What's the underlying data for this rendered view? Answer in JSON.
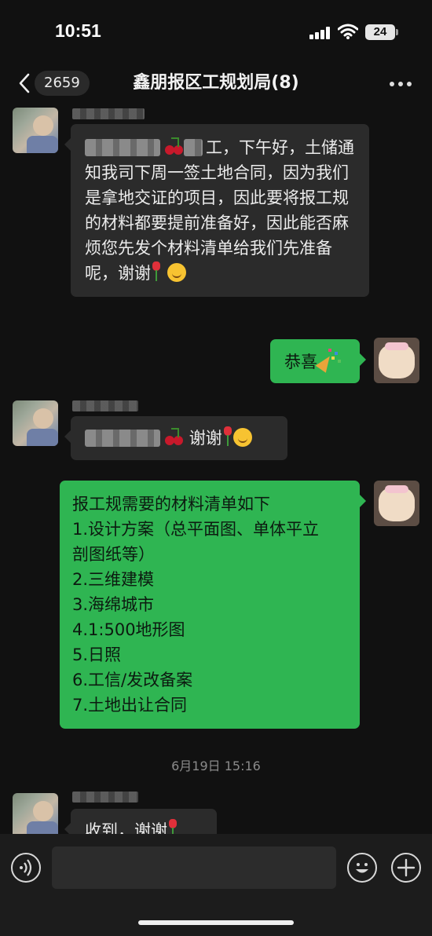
{
  "status_bar": {
    "time": "10:51",
    "battery_level": "24"
  },
  "nav": {
    "back_icon": "chevron-left-icon",
    "unread_count": "2659",
    "title": "鑫朋报区工规划局(8)",
    "more_icon": "more-dots-icon"
  },
  "messages": [
    {
      "side": "left",
      "text_after_name": "工，下午好，土储通知我司下周一签土地合同，因为我们是拿地交证的项目，因此要将报工规的材料都要提前准备好，因此能否麻烦您先发个材料清单给我们先准备呢，谢谢",
      "emojis": [
        "cherry",
        "tulip",
        "smile"
      ]
    },
    {
      "side": "right",
      "text": "恭喜",
      "emojis": [
        "party-popper"
      ]
    },
    {
      "side": "left",
      "text_after_name": "谢谢",
      "emojis": [
        "cherry",
        "tulip",
        "smile"
      ]
    },
    {
      "side": "right",
      "lines": [
        "报工规需要的材料清单如下",
        "1.设计方案（总平面图、单体平立",
        "剖图纸等）",
        "2.三维建模",
        "3.海绵城市",
        "4.1:500地形图",
        "5.日照",
        "6.工信/发改备案",
        "7.土地出让合同"
      ]
    },
    {
      "side": "left",
      "text": "收到，谢谢",
      "emojis": [
        "tulip"
      ]
    }
  ],
  "timestamp": "6月19日 15:16",
  "input_bar": {
    "voice_icon": "voice-icon",
    "emoji_icon": "emoji-face-icon",
    "plus_icon": "plus-icon"
  },
  "colors": {
    "background": "#111111",
    "incoming_bubble": "#2b2b2b",
    "outgoing_bubble": "#2fb552"
  }
}
